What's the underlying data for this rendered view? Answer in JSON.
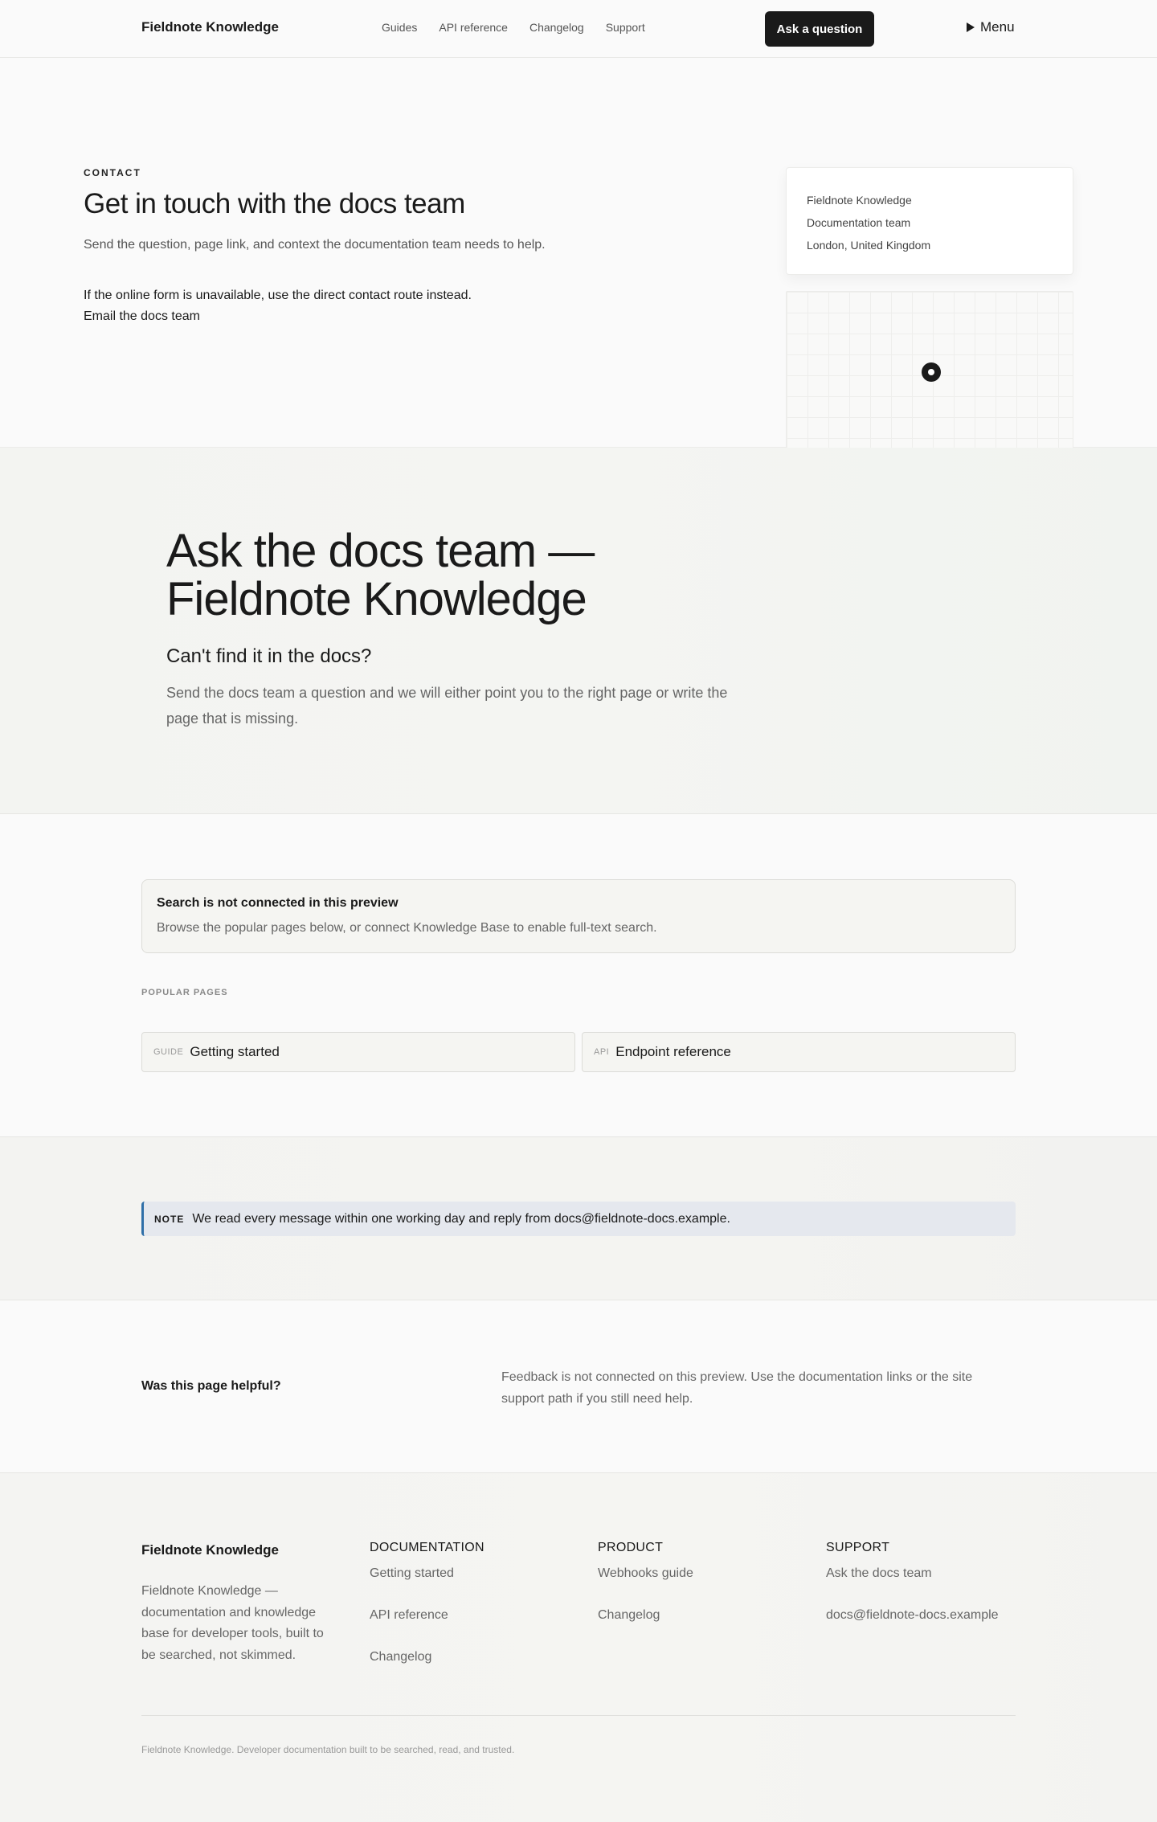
{
  "header": {
    "brand": "Fieldnote Knowledge",
    "nav": [
      "Guides",
      "API reference",
      "Changelog",
      "Support"
    ],
    "cta": "Ask a question",
    "menu": "Menu"
  },
  "contact": {
    "eyebrow": "CONTACT",
    "title": "Get in touch with the docs team",
    "lead": "Send the question, page link, and context the documentation team needs to help.",
    "fallback_line1": "If the online form is unavailable, use the direct contact route instead.",
    "fallback_line2": "Email the docs team",
    "address": [
      "Fieldnote Knowledge",
      "Documentation team",
      "London, United Kingdom"
    ]
  },
  "hero": {
    "title": "Ask the docs team — Fieldnote Knowledge",
    "subtitle": "Can't find it in the docs?",
    "body": "Send the docs team a question and we will either point you to the right page or write the page that is missing."
  },
  "search": {
    "notice_title": "Search is not connected in this preview",
    "notice_body": "Browse the popular pages below, or connect Knowledge Base to enable full-text search.",
    "popular_label": "POPULAR PAGES",
    "pages": [
      {
        "tag": "GUIDE",
        "name": "Getting started"
      },
      {
        "tag": "API",
        "name": "Endpoint reference"
      }
    ]
  },
  "note": {
    "label": "NOTE",
    "message": "We read every message within one working day and reply from docs@fieldnote-docs.example."
  },
  "feedback": {
    "question": "Was this page helpful?",
    "answer": "Feedback is not connected on this preview. Use the documentation links or the site support path if you still need help."
  },
  "footer": {
    "brand": "Fieldnote Knowledge",
    "description": "Fieldnote Knowledge — documentation and knowledge base for developer tools, built to be searched, not skimmed.",
    "columns": [
      {
        "heading": "DOCUMENTATION",
        "links": [
          "Getting started",
          "API reference",
          "Changelog"
        ]
      },
      {
        "heading": "PRODUCT",
        "links": [
          "Webhooks guide",
          "Changelog"
        ]
      },
      {
        "heading": "SUPPORT",
        "links": [
          "Ask the docs team",
          "docs@fieldnote-docs.example"
        ]
      }
    ],
    "bottom": "Fieldnote Knowledge. Developer documentation built to be searched, read, and trusted."
  }
}
